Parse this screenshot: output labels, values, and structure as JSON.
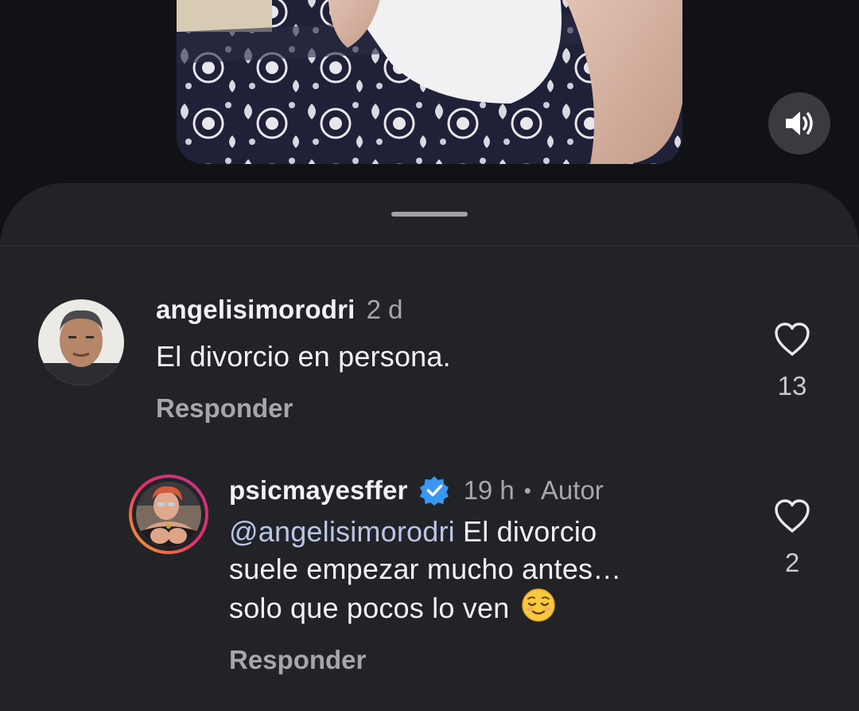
{
  "video": {
    "mute_icon": "speaker-volume-icon"
  },
  "comments": [
    {
      "username": "angelisimorodri",
      "time": "2 d",
      "text": "El divorcio en persona.",
      "reply_label": "Responder",
      "like_count": "13",
      "like_icon": "heart-outline-icon"
    }
  ],
  "reply": {
    "username": "psicmayesffer",
    "verified_icon": "verified-badge-icon",
    "time": "19 h",
    "separator": "•",
    "author_tag": "Autor",
    "mention": "@angelisimorodri",
    "text_line1_rest": " El divorcio",
    "text_line2": "suele empezar mucho antes…",
    "text_line3": "solo que pocos lo ven",
    "emoji_icon": "relieved-face-emoji",
    "reply_label": "Responder",
    "like_count": "2",
    "like_icon": "heart-outline-icon"
  },
  "colors": {
    "background": "#101216",
    "sheet": "#222327",
    "verified_blue": "#3897f0",
    "story_ring_start": "#f9a825",
    "story_ring_end": "#c13584"
  }
}
